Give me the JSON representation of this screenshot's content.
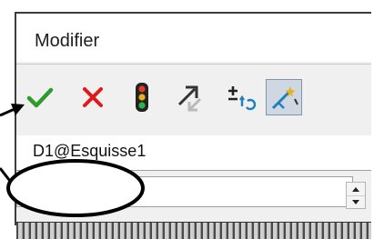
{
  "dialog": {
    "title": "Modifier",
    "name_value": "D1@Esquisse1",
    "value_input": ""
  },
  "toolbar": {
    "buttons": [
      {
        "name": "ok",
        "icon": "checkmark-icon",
        "color": "#2e9b2e"
      },
      {
        "name": "cancel",
        "icon": "x-icon",
        "color": "#e01a1a"
      },
      {
        "name": "rebuild",
        "icon": "traffic-light-icon",
        "color": "#222222"
      },
      {
        "name": "reverse",
        "icon": "diagonal-arrows-icon",
        "color": "#333333"
      },
      {
        "name": "increment",
        "icon": "plus-minus-reset-icon",
        "color": "#1f7fbf"
      },
      {
        "name": "mark-dimension",
        "icon": "magic-wand-dimension-icon",
        "color": "#1f7fbf",
        "active": true
      }
    ]
  },
  "colors": {
    "annotation": "#000000",
    "active_button_bg": "#cfd8e2",
    "active_button_border": "#7f95ad"
  }
}
